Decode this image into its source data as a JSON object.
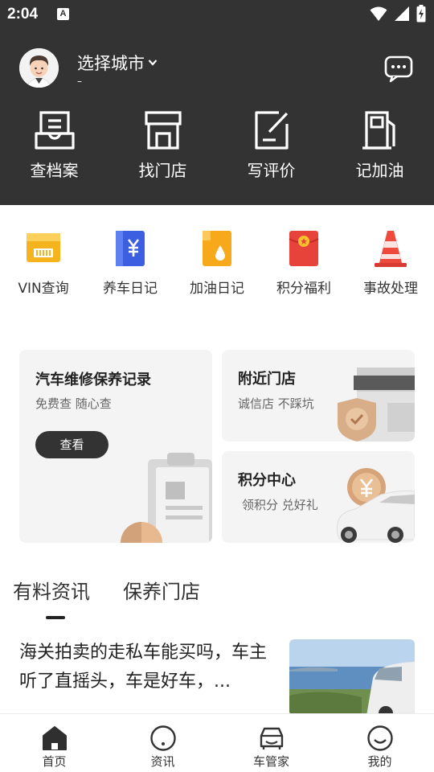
{
  "status_bar": {
    "time": "2:04",
    "badge": "A"
  },
  "header": {
    "city_label": "选择城市",
    "sub_label": "–"
  },
  "top_actions": [
    {
      "label": "查档案",
      "icon": "archive-icon"
    },
    {
      "label": "找门店",
      "icon": "store-icon"
    },
    {
      "label": "写评价",
      "icon": "edit-review-icon"
    },
    {
      "label": "记加油",
      "icon": "fuel-pump-icon"
    }
  ],
  "quick_items": [
    {
      "label": "VIN查询",
      "icon": "vin-card-icon",
      "color": "#f5b41e"
    },
    {
      "label": "养车日记",
      "icon": "yen-book-icon",
      "color": "#3b5fe0"
    },
    {
      "label": "加油日记",
      "icon": "oil-drop-icon",
      "color": "#f7a81b"
    },
    {
      "label": "积分福利",
      "icon": "red-envelope-icon",
      "color": "#e8433b"
    },
    {
      "label": "事故处理",
      "icon": "traffic-cone-icon",
      "color": "#ee4b3e"
    }
  ],
  "cards": {
    "maintenance": {
      "title": "汽车维修保养记录",
      "subtitle": "免费查 随心查",
      "button": "查看"
    },
    "nearby": {
      "title": "附近门店",
      "subtitle": "诚信店 不踩坑"
    },
    "points": {
      "title": "积分中心",
      "subtitle": "领积分 兑好礼"
    }
  },
  "tabs": [
    {
      "label": "有料资讯"
    },
    {
      "label": "保养门店"
    }
  ],
  "news": [
    {
      "title": "海关拍卖的走私车能买吗，车主听了直摇头，车是好车，..."
    }
  ],
  "bottom_nav": [
    {
      "label": "首页",
      "icon": "home-icon"
    },
    {
      "label": "资讯",
      "icon": "news-icon"
    },
    {
      "label": "车管家",
      "icon": "car-butler-icon"
    },
    {
      "label": "我的",
      "icon": "profile-icon"
    }
  ],
  "colors": {
    "header_bg": "#333333",
    "card_bg": "#f4f4f4",
    "accent_dark": "#333333"
  }
}
